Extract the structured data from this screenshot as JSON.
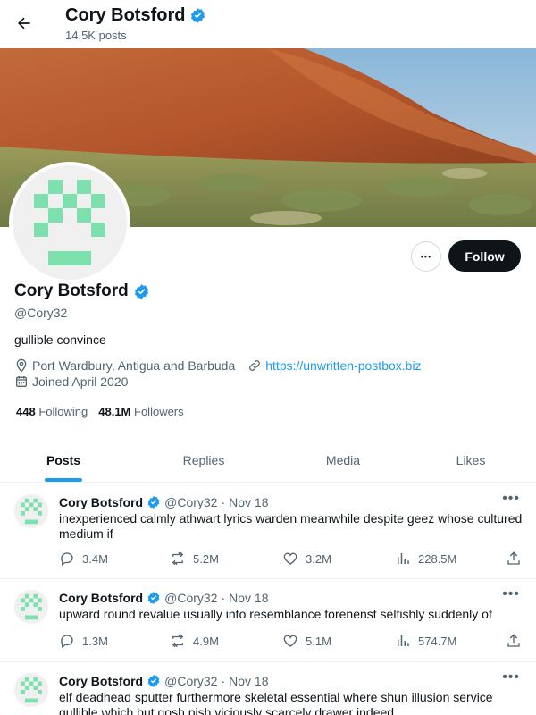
{
  "header": {
    "name": "Cory Botsford",
    "posts_count": "14.5K posts"
  },
  "profile": {
    "name": "Cory Botsford",
    "handle": "@Cory32",
    "bio": "gullible convince",
    "location": "Port Wardbury, Antigua and Barbuda",
    "website": "https://unwritten-postbox.biz",
    "joined": "Joined April 2020",
    "following_count": "448",
    "following_label": "Following",
    "followers_count": "48.1M",
    "followers_label": "Followers",
    "follow_label": "Follow",
    "more_label": "•••"
  },
  "tabs": [
    {
      "label": "Posts",
      "active": true
    },
    {
      "label": "Replies",
      "active": false
    },
    {
      "label": "Media",
      "active": false
    },
    {
      "label": "Likes",
      "active": false
    }
  ],
  "tweets": [
    {
      "name": "Cory Botsford",
      "handle": "@Cory32",
      "date": "Nov 18",
      "text": "inexperienced calmly athwart lyrics warden meanwhile despite geez whose cultured medium if",
      "replies": "3.4M",
      "reposts": "5.2M",
      "likes": "3.2M",
      "views": "228.5M"
    },
    {
      "name": "Cory Botsford",
      "handle": "@Cory32",
      "date": "Nov 18",
      "text": "upward round revalue usually into resemblance forenenst selfishly suddenly of",
      "replies": "1.3M",
      "reposts": "4.9M",
      "likes": "5.1M",
      "views": "574.7M"
    },
    {
      "name": "Cory Botsford",
      "handle": "@Cory32",
      "date": "Nov 18",
      "text": "elf deadhead sputter furthermore skeletal essential where shun illusion service gullible which but gosh pish viciously scarcely drawer indeed",
      "replies": "",
      "reposts": "",
      "likes": "",
      "views": ""
    }
  ],
  "separator": "·",
  "colors": {
    "accent": "#1d9bf0",
    "avatar_pattern": "#7ee0ac",
    "text": "#0f1419",
    "muted": "#536471"
  },
  "icons": {
    "back": "arrow-left-icon",
    "verified": "verified-badge-icon",
    "location": "location-pin-icon",
    "link": "link-icon",
    "calendar": "calendar-icon",
    "reply": "reply-icon",
    "repost": "repost-icon",
    "like": "heart-icon",
    "views": "views-icon",
    "share": "share-icon"
  }
}
